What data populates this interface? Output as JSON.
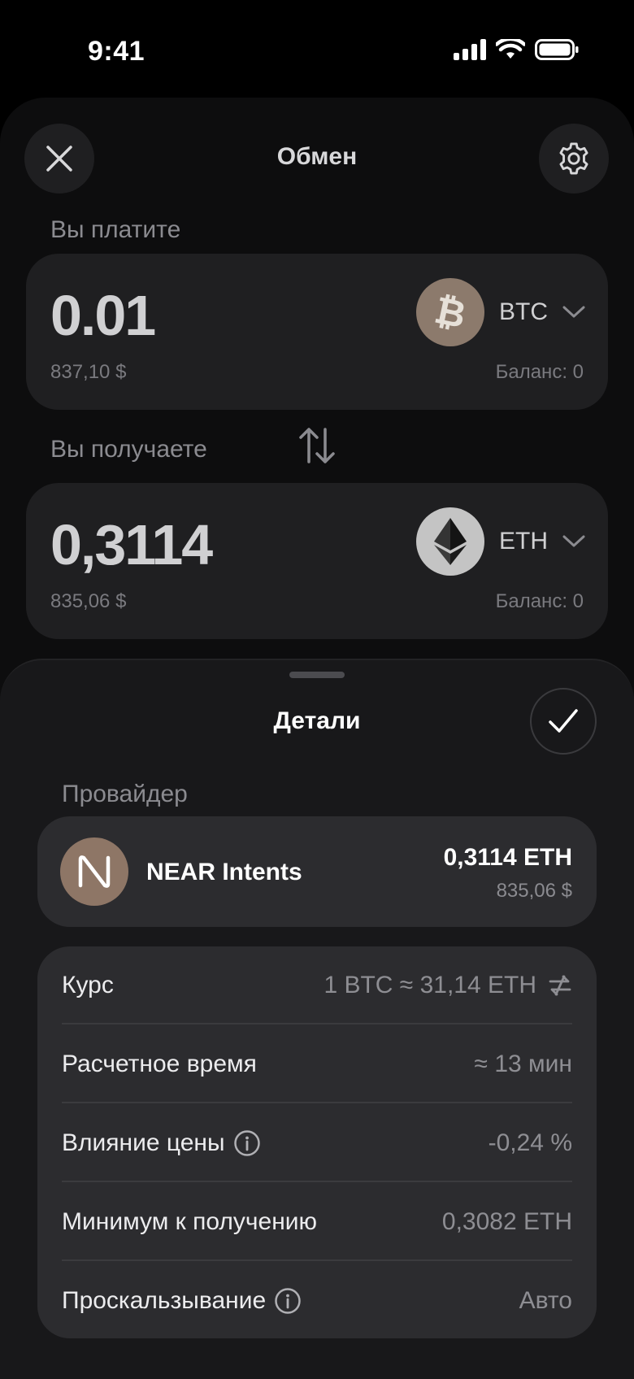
{
  "status_bar": {
    "time": "9:41"
  },
  "header": {
    "title": "Обмен"
  },
  "pay": {
    "label": "Вы платите",
    "amount": "0.01",
    "fiat": "837,10 $",
    "token": "BTC",
    "balance": "Баланс: 0"
  },
  "receive": {
    "label": "Вы получаете",
    "amount": "0,3114",
    "fiat": "835,06 $",
    "token": "ETH",
    "balance": "Баланс: 0"
  },
  "details": {
    "title": "Детали",
    "provider_label": "Провайдер",
    "provider": {
      "name": "NEAR Intents",
      "amount": "0,3114 ETH",
      "fiat": "835,06 $"
    },
    "rows": [
      {
        "label": "Курс",
        "value": "1 BTC ≈ 31,14 ETH"
      },
      {
        "label": "Расчетное время",
        "value": "≈ 13 мин"
      },
      {
        "label": "Влияние цены",
        "value": "-0,24 %"
      },
      {
        "label": "Минимум к получению",
        "value": "0,3082 ETH"
      },
      {
        "label": "Проскальзывание",
        "value": "Авто"
      }
    ]
  },
  "icons": {
    "close": "close-icon",
    "settings": "gear-icon",
    "swap": "swap-arrows-icon",
    "confirm": "checkmark-icon",
    "info": "info-icon",
    "invert_rate": "invert-rate-icon"
  },
  "colors": {
    "background": "#000000",
    "card": "#1f1f21",
    "details_card": "#2c2c2f",
    "btc_logo": "#8c7a6c",
    "eth_logo": "#c4c4c4",
    "near_logo": "#8e7666"
  }
}
